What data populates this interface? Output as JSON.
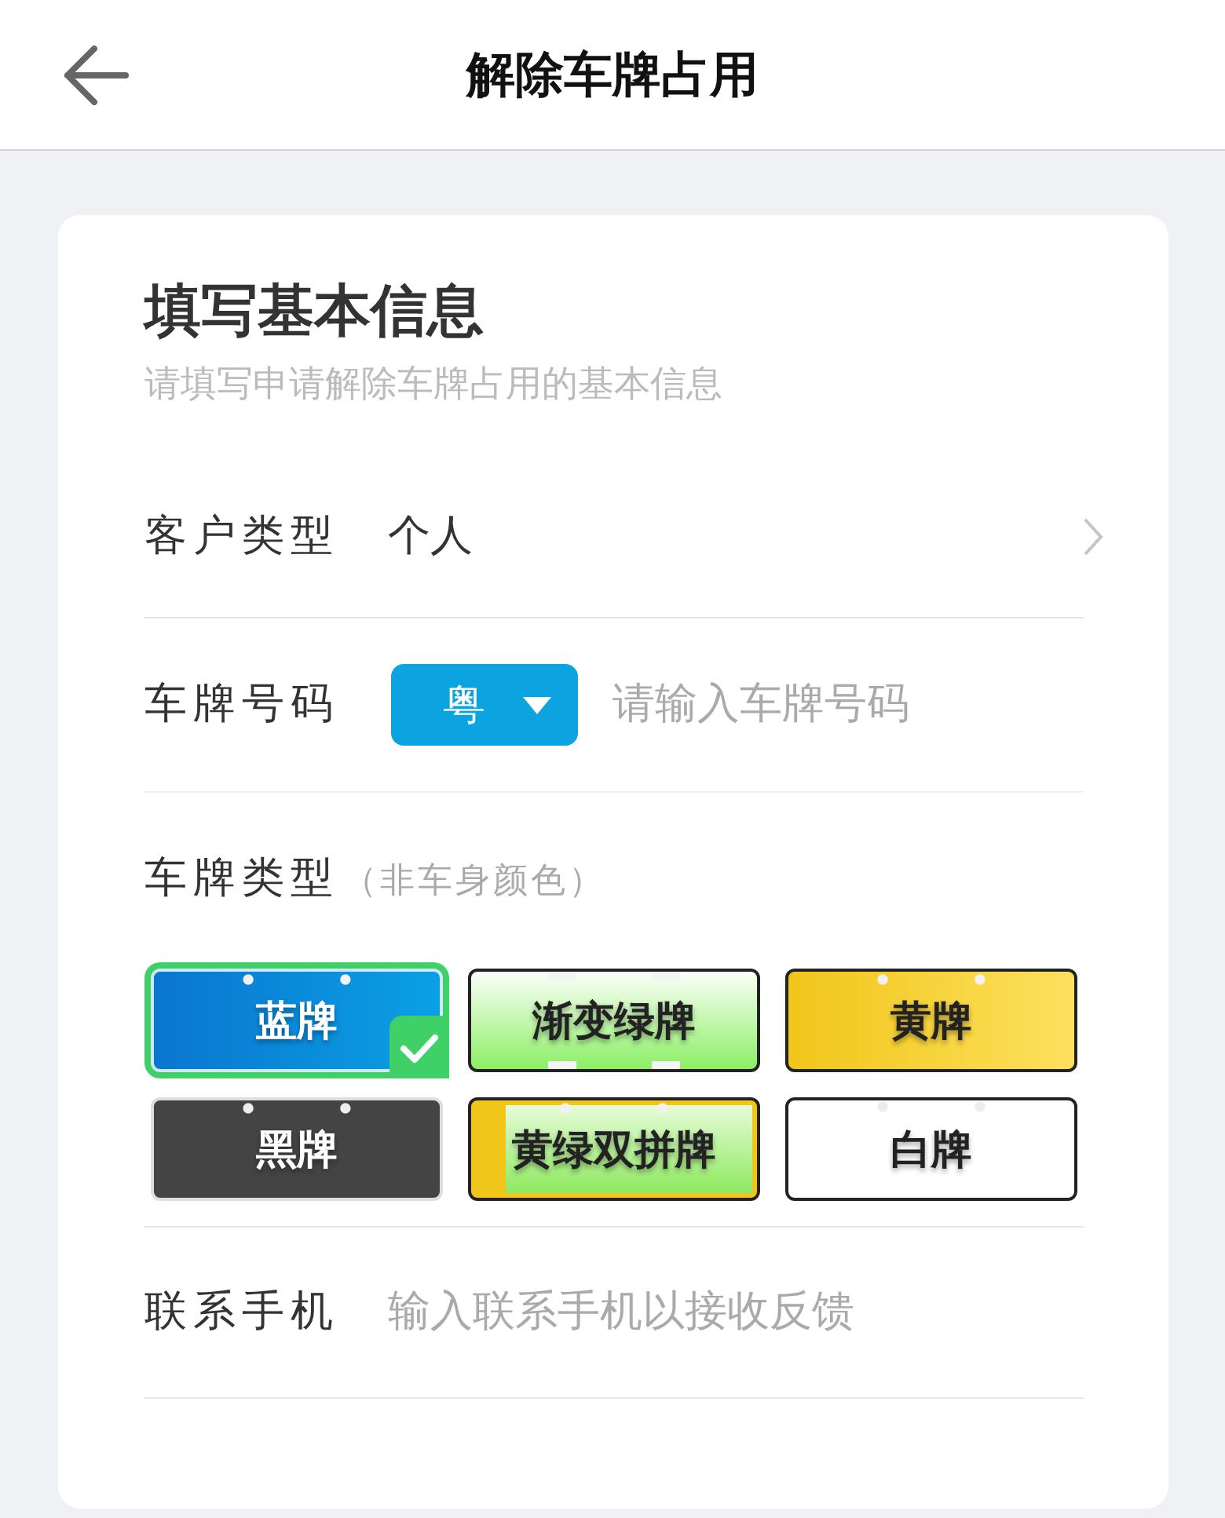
{
  "header": {
    "title": "解除车牌占用"
  },
  "form": {
    "title": "填写基本信息",
    "subtitle": "请填写申请解除车牌占用的基本信息",
    "customer_type": {
      "label": "客户类型",
      "value": "个人"
    },
    "plate_number": {
      "label": "车牌号码",
      "province": "粤",
      "placeholder": "请输入车牌号码"
    },
    "plate_type": {
      "label": "车牌类型",
      "note": "（非车身颜色）",
      "options": [
        {
          "label": "蓝牌",
          "kind": "blue",
          "selected": true
        },
        {
          "label": "渐变绿牌",
          "kind": "green",
          "selected": false
        },
        {
          "label": "黄牌",
          "kind": "yellow",
          "selected": false
        },
        {
          "label": "黑牌",
          "kind": "black",
          "selected": false
        },
        {
          "label": "黄绿双拼牌",
          "kind": "dual",
          "selected": false
        },
        {
          "label": "白牌",
          "kind": "white",
          "selected": false
        }
      ]
    },
    "phone": {
      "label": "联系手机",
      "placeholder": "输入联系手机以接收反馈"
    }
  }
}
